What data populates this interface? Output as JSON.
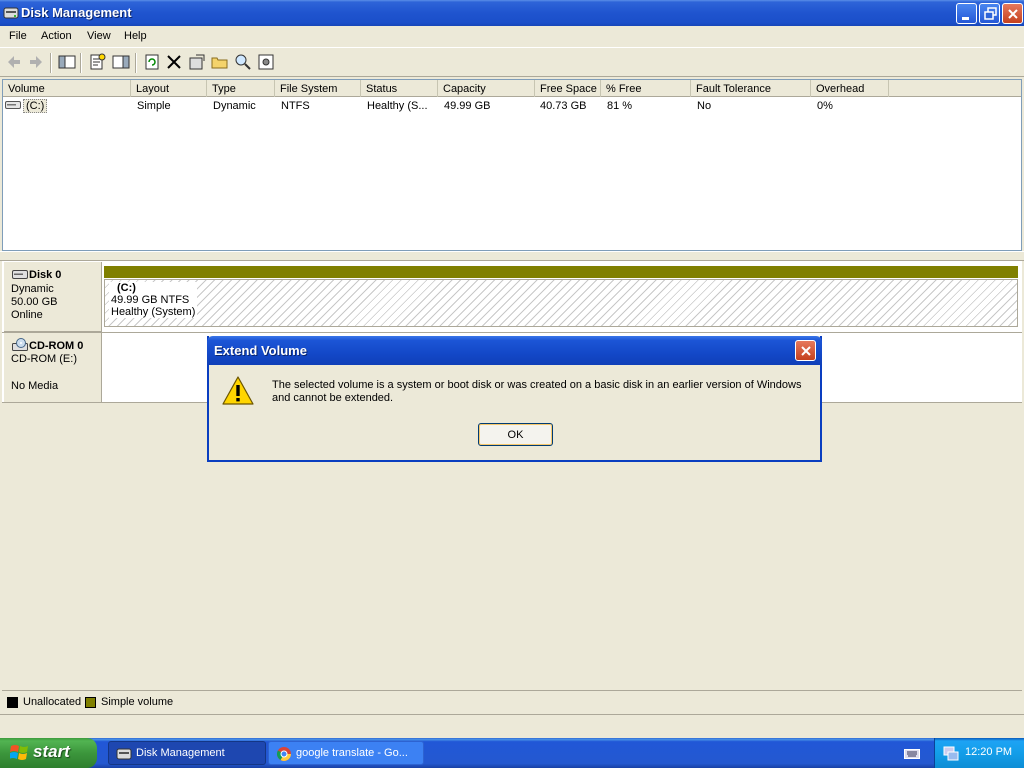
{
  "window": {
    "title": "Disk Management"
  },
  "menu": [
    "File",
    "Action",
    "View",
    "Help"
  ],
  "volume_list": {
    "columns": [
      "Volume",
      "Layout",
      "Type",
      "File System",
      "Status",
      "Capacity",
      "Free Space",
      "% Free",
      "Fault Tolerance",
      "Overhead"
    ],
    "rows": [
      [
        "(C:)",
        "Simple",
        "Dynamic",
        "NTFS",
        "Healthy (S...",
        "49.99 GB",
        "40.73 GB",
        "81 %",
        "No",
        "0%"
      ]
    ]
  },
  "disks": [
    {
      "name": "Disk 0",
      "type": "Dynamic",
      "size": "50.00 GB",
      "state": "Online",
      "volume": {
        "label": "(C:)",
        "detail": "49.99 GB NTFS",
        "status": "Healthy (System)"
      }
    },
    {
      "name": "CD-ROM 0",
      "type": "CD-ROM (E:)",
      "state": "No Media"
    }
  ],
  "legend": [
    {
      "label": "Unallocated",
      "color": "#000000"
    },
    {
      "label": "Simple volume",
      "color": "#808000"
    }
  ],
  "dialog": {
    "title": "Extend Volume",
    "icon": "warning-icon",
    "message": "The selected volume is a system or boot disk or was created on a basic disk in an earlier version of Windows and cannot be extended.",
    "ok_label": "OK"
  },
  "taskbar": {
    "start_label": "start",
    "tasks": [
      "Disk Management",
      "google translate - Go..."
    ],
    "clock": "12:20 PM"
  }
}
